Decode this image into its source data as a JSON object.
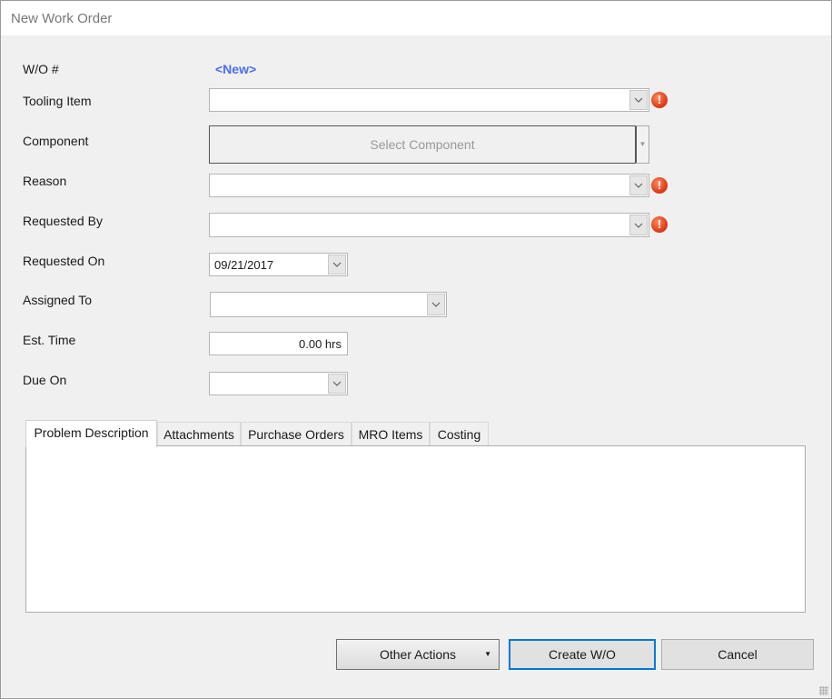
{
  "window": {
    "title": "New Work Order"
  },
  "form": {
    "wo_label": "W/O #",
    "wo_value": "<New>",
    "tooling_label": "Tooling Item",
    "tooling_value": "",
    "component_label": "Component",
    "component_button": "Select Component",
    "reason_label": "Reason",
    "reason_value": "",
    "requested_by_label": "Requested By",
    "requested_by_value": "",
    "requested_on_label": "Requested On",
    "requested_on_value": "09/21/2017",
    "assigned_to_label": "Assigned To",
    "assigned_to_value": "",
    "est_time_label": "Est. Time",
    "est_time_value": "0.00 hrs",
    "due_on_label": "Due On",
    "due_on_value": ""
  },
  "tabs": [
    {
      "label": "Problem Description",
      "active": true
    },
    {
      "label": "Attachments"
    },
    {
      "label": "Purchase Orders"
    },
    {
      "label": "MRO Items"
    },
    {
      "label": "Costing"
    }
  ],
  "buttons": {
    "other_actions": "Other Actions",
    "create": "Create W/O",
    "cancel": "Cancel"
  },
  "colors": {
    "accent": "#4a6cf7",
    "focus_border": "#0078d7",
    "error": "#e0401a"
  },
  "icons": {
    "error": "exclamation-circle-icon",
    "dropdown": "chevron-down-icon"
  }
}
